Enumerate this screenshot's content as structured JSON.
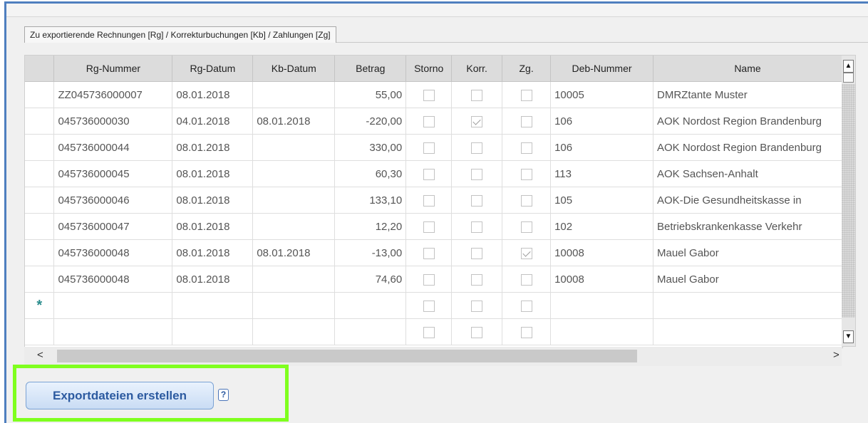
{
  "section": {
    "tab_label": "Zu exportierende Rechnungen [Rg] / Korrekturbuchungen [Kb] / Zahlungen [Zg]"
  },
  "grid": {
    "columns": [
      "Rg-Nummer",
      "Rg-Datum",
      "Kb-Datum",
      "Betrag",
      "Storno",
      "Korr.",
      "Zg.",
      "Deb-Nummer",
      "Name"
    ],
    "rows": [
      {
        "rg_nummer": "ZZ045736000007",
        "rg_datum": "08.01.2018",
        "kb_datum": "",
        "betrag": "55,00",
        "storno": false,
        "korr": false,
        "zg": false,
        "deb_nummer": "10005",
        "name": "DMRZtante Muster"
      },
      {
        "rg_nummer": "045736000030",
        "rg_datum": "04.01.2018",
        "kb_datum": "08.01.2018",
        "betrag": "-220,00",
        "storno": false,
        "korr": true,
        "zg": false,
        "deb_nummer": "106",
        "name": "AOK Nordost Region Brandenburg"
      },
      {
        "rg_nummer": "045736000044",
        "rg_datum": "08.01.2018",
        "kb_datum": "",
        "betrag": "330,00",
        "storno": false,
        "korr": false,
        "zg": false,
        "deb_nummer": "106",
        "name": "AOK Nordost Region Brandenburg"
      },
      {
        "rg_nummer": "045736000045",
        "rg_datum": "08.01.2018",
        "kb_datum": "",
        "betrag": "60,30",
        "storno": false,
        "korr": false,
        "zg": false,
        "deb_nummer": "113",
        "name": "AOK Sachsen-Anhalt"
      },
      {
        "rg_nummer": "045736000046",
        "rg_datum": "08.01.2018",
        "kb_datum": "",
        "betrag": "133,10",
        "storno": false,
        "korr": false,
        "zg": false,
        "deb_nummer": "105",
        "name": "AOK-Die Gesundheitskasse in"
      },
      {
        "rg_nummer": "045736000047",
        "rg_datum": "08.01.2018",
        "kb_datum": "",
        "betrag": "12,20",
        "storno": false,
        "korr": false,
        "zg": false,
        "deb_nummer": "102",
        "name": "Betriebskrankenkasse Verkehr"
      },
      {
        "rg_nummer": "045736000048",
        "rg_datum": "08.01.2018",
        "kb_datum": "08.01.2018",
        "betrag": "-13,00",
        "storno": false,
        "korr": false,
        "zg": true,
        "deb_nummer": "10008",
        "name": "Mauel Gabor"
      },
      {
        "rg_nummer": "045736000048",
        "rg_datum": "08.01.2018",
        "kb_datum": "",
        "betrag": "74,60",
        "storno": false,
        "korr": false,
        "zg": false,
        "deb_nummer": "10008",
        "name": "Mauel Gabor"
      }
    ],
    "new_row_marker": "*"
  },
  "scrollbars": {
    "up_arrow": "▲",
    "down_arrow": "▼",
    "left_arrow": "<",
    "right_arrow": ">"
  },
  "actions": {
    "export_label": "Exportdateien erstellen",
    "help_label": "?",
    "highlight_color": "#7fff1e"
  },
  "colors": {
    "frame_border": "#4f7fbf",
    "button_text": "#2c5aa0"
  }
}
